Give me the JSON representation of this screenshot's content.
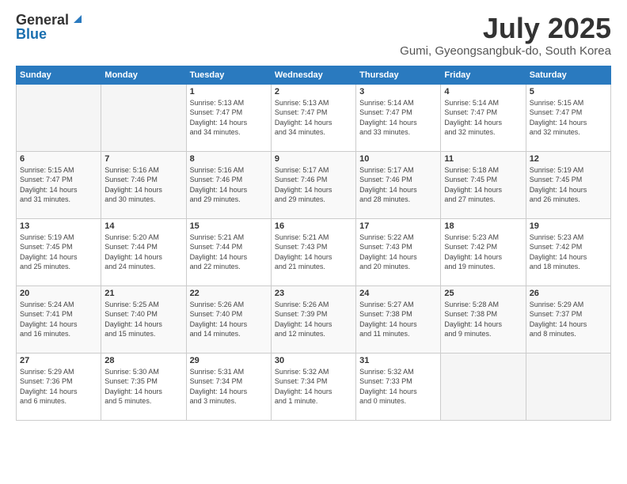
{
  "logo": {
    "general": "General",
    "blue": "Blue"
  },
  "header": {
    "title": "July 2025",
    "subtitle": "Gumi, Gyeongsangbuk-do, South Korea"
  },
  "weekdays": [
    "Sunday",
    "Monday",
    "Tuesday",
    "Wednesday",
    "Thursday",
    "Friday",
    "Saturday"
  ],
  "weeks": [
    [
      {
        "day": "",
        "info": ""
      },
      {
        "day": "",
        "info": ""
      },
      {
        "day": "1",
        "info": "Sunrise: 5:13 AM\nSunset: 7:47 PM\nDaylight: 14 hours\nand 34 minutes."
      },
      {
        "day": "2",
        "info": "Sunrise: 5:13 AM\nSunset: 7:47 PM\nDaylight: 14 hours\nand 34 minutes."
      },
      {
        "day": "3",
        "info": "Sunrise: 5:14 AM\nSunset: 7:47 PM\nDaylight: 14 hours\nand 33 minutes."
      },
      {
        "day": "4",
        "info": "Sunrise: 5:14 AM\nSunset: 7:47 PM\nDaylight: 14 hours\nand 32 minutes."
      },
      {
        "day": "5",
        "info": "Sunrise: 5:15 AM\nSunset: 7:47 PM\nDaylight: 14 hours\nand 32 minutes."
      }
    ],
    [
      {
        "day": "6",
        "info": "Sunrise: 5:15 AM\nSunset: 7:47 PM\nDaylight: 14 hours\nand 31 minutes."
      },
      {
        "day": "7",
        "info": "Sunrise: 5:16 AM\nSunset: 7:46 PM\nDaylight: 14 hours\nand 30 minutes."
      },
      {
        "day": "8",
        "info": "Sunrise: 5:16 AM\nSunset: 7:46 PM\nDaylight: 14 hours\nand 29 minutes."
      },
      {
        "day": "9",
        "info": "Sunrise: 5:17 AM\nSunset: 7:46 PM\nDaylight: 14 hours\nand 29 minutes."
      },
      {
        "day": "10",
        "info": "Sunrise: 5:17 AM\nSunset: 7:46 PM\nDaylight: 14 hours\nand 28 minutes."
      },
      {
        "day": "11",
        "info": "Sunrise: 5:18 AM\nSunset: 7:45 PM\nDaylight: 14 hours\nand 27 minutes."
      },
      {
        "day": "12",
        "info": "Sunrise: 5:19 AM\nSunset: 7:45 PM\nDaylight: 14 hours\nand 26 minutes."
      }
    ],
    [
      {
        "day": "13",
        "info": "Sunrise: 5:19 AM\nSunset: 7:45 PM\nDaylight: 14 hours\nand 25 minutes."
      },
      {
        "day": "14",
        "info": "Sunrise: 5:20 AM\nSunset: 7:44 PM\nDaylight: 14 hours\nand 24 minutes."
      },
      {
        "day": "15",
        "info": "Sunrise: 5:21 AM\nSunset: 7:44 PM\nDaylight: 14 hours\nand 22 minutes."
      },
      {
        "day": "16",
        "info": "Sunrise: 5:21 AM\nSunset: 7:43 PM\nDaylight: 14 hours\nand 21 minutes."
      },
      {
        "day": "17",
        "info": "Sunrise: 5:22 AM\nSunset: 7:43 PM\nDaylight: 14 hours\nand 20 minutes."
      },
      {
        "day": "18",
        "info": "Sunrise: 5:23 AM\nSunset: 7:42 PM\nDaylight: 14 hours\nand 19 minutes."
      },
      {
        "day": "19",
        "info": "Sunrise: 5:23 AM\nSunset: 7:42 PM\nDaylight: 14 hours\nand 18 minutes."
      }
    ],
    [
      {
        "day": "20",
        "info": "Sunrise: 5:24 AM\nSunset: 7:41 PM\nDaylight: 14 hours\nand 16 minutes."
      },
      {
        "day": "21",
        "info": "Sunrise: 5:25 AM\nSunset: 7:40 PM\nDaylight: 14 hours\nand 15 minutes."
      },
      {
        "day": "22",
        "info": "Sunrise: 5:26 AM\nSunset: 7:40 PM\nDaylight: 14 hours\nand 14 minutes."
      },
      {
        "day": "23",
        "info": "Sunrise: 5:26 AM\nSunset: 7:39 PM\nDaylight: 14 hours\nand 12 minutes."
      },
      {
        "day": "24",
        "info": "Sunrise: 5:27 AM\nSunset: 7:38 PM\nDaylight: 14 hours\nand 11 minutes."
      },
      {
        "day": "25",
        "info": "Sunrise: 5:28 AM\nSunset: 7:38 PM\nDaylight: 14 hours\nand 9 minutes."
      },
      {
        "day": "26",
        "info": "Sunrise: 5:29 AM\nSunset: 7:37 PM\nDaylight: 14 hours\nand 8 minutes."
      }
    ],
    [
      {
        "day": "27",
        "info": "Sunrise: 5:29 AM\nSunset: 7:36 PM\nDaylight: 14 hours\nand 6 minutes."
      },
      {
        "day": "28",
        "info": "Sunrise: 5:30 AM\nSunset: 7:35 PM\nDaylight: 14 hours\nand 5 minutes."
      },
      {
        "day": "29",
        "info": "Sunrise: 5:31 AM\nSunset: 7:34 PM\nDaylight: 14 hours\nand 3 minutes."
      },
      {
        "day": "30",
        "info": "Sunrise: 5:32 AM\nSunset: 7:34 PM\nDaylight: 14 hours\nand 1 minute."
      },
      {
        "day": "31",
        "info": "Sunrise: 5:32 AM\nSunset: 7:33 PM\nDaylight: 14 hours\nand 0 minutes."
      },
      {
        "day": "",
        "info": ""
      },
      {
        "day": "",
        "info": ""
      }
    ]
  ]
}
